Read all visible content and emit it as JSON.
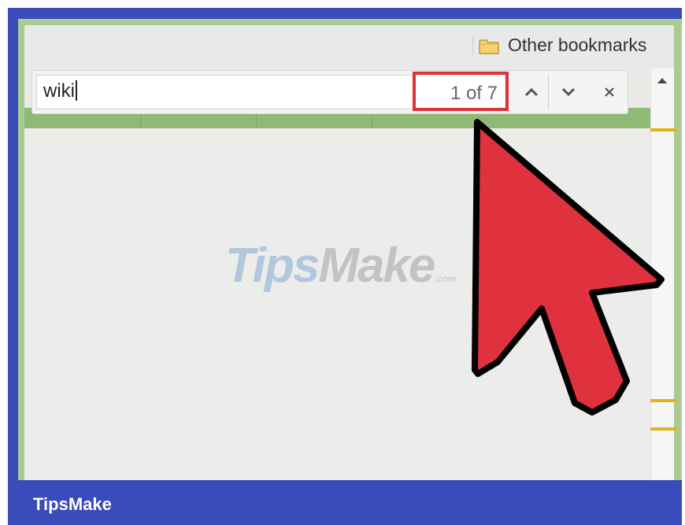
{
  "bookmarks_bar": {
    "other_bookmarks_label": "Other bookmarks",
    "folder_icon": "folder-icon"
  },
  "find_bar": {
    "query": "wiki",
    "match_count": "1 of 7",
    "prev_icon": "chevron-up-icon",
    "next_icon": "chevron-down-icon",
    "close_icon": "close-icon"
  },
  "scrollbar": {
    "up_icon": "scroll-up-arrow-icon"
  },
  "watermark": {
    "tips": "Tips",
    "make": "Make",
    "suffix": ".com"
  },
  "footer": {
    "brand": "TipsMake"
  },
  "colors": {
    "frame_blue": "#3a4bbb",
    "highlight_red": "#dc3137",
    "arrow_red": "#e0323e",
    "accent_green": "#a9cc93",
    "match_marker": "#e0b51c"
  }
}
